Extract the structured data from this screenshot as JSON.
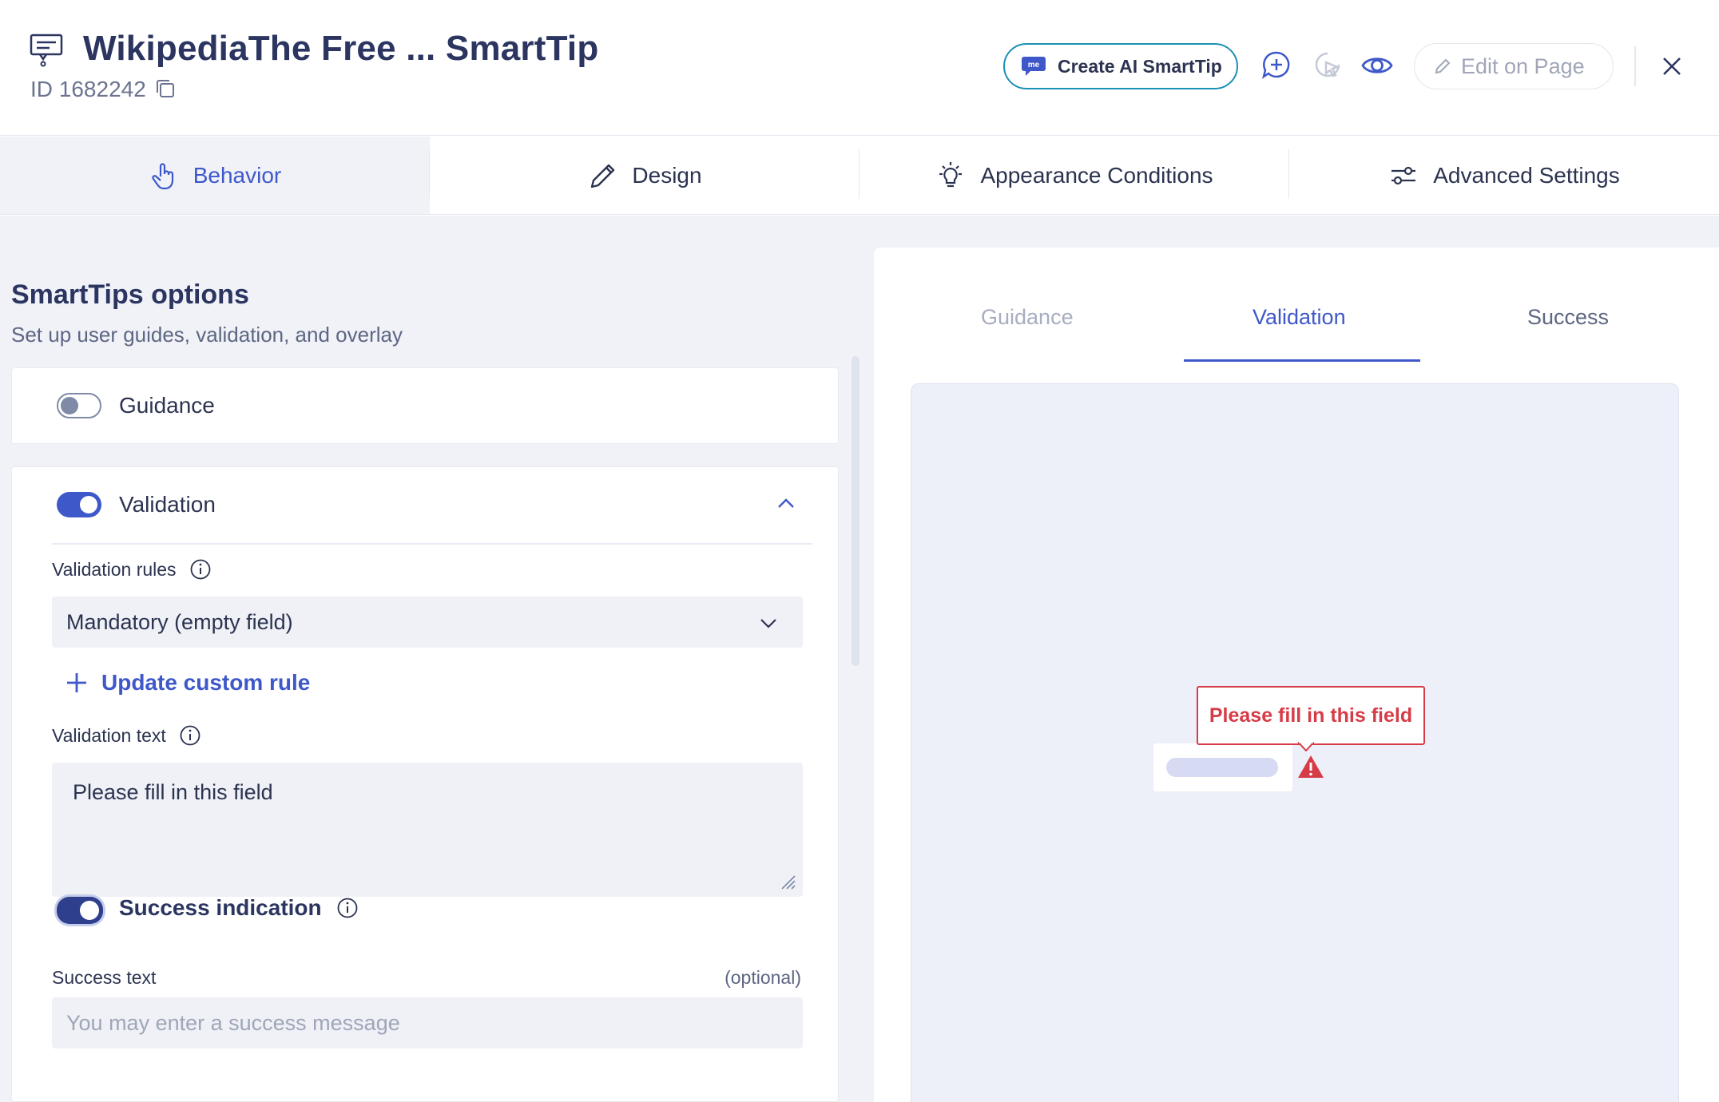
{
  "header": {
    "title": "WikipediaThe Free ... SmartTip",
    "id_text": "ID 1682242",
    "create_ai_label": "Create AI SmartTip",
    "ai_badge_text": "me",
    "edit_on_page_label": "Edit on Page"
  },
  "tabs": [
    {
      "label": "Behavior",
      "icon": "hand-pointer-icon",
      "active": true
    },
    {
      "label": "Design",
      "icon": "pencil-icon",
      "active": false
    },
    {
      "label": "Appearance Conditions",
      "icon": "lightbulb-icon",
      "active": false
    },
    {
      "label": "Advanced Settings",
      "icon": "sliders-icon",
      "active": false
    }
  ],
  "options": {
    "title": "SmartTips options",
    "subtitle": "Set up user guides, validation, and overlay",
    "guidance": {
      "label": "Guidance",
      "enabled": false
    },
    "validation": {
      "label": "Validation",
      "enabled": true,
      "rules_label": "Validation rules",
      "rule_value": "Mandatory (empty field)",
      "update_rule_label": "Update custom rule",
      "text_label": "Validation text",
      "text_value": "Please fill in this field",
      "success_indication_label": "Success indication",
      "success_indication_enabled": true,
      "success_text_label": "Success text",
      "success_text_optional": "(optional)",
      "success_text_placeholder": "You may enter a success message"
    }
  },
  "preview": {
    "tabs": [
      "Guidance",
      "Validation",
      "Success"
    ],
    "active_tab": "Validation",
    "tooltip_text": "Please fill in this field"
  },
  "colors": {
    "accent": "#3f58c9",
    "error": "#d63c47",
    "ai_border": "#1c8fb4"
  }
}
